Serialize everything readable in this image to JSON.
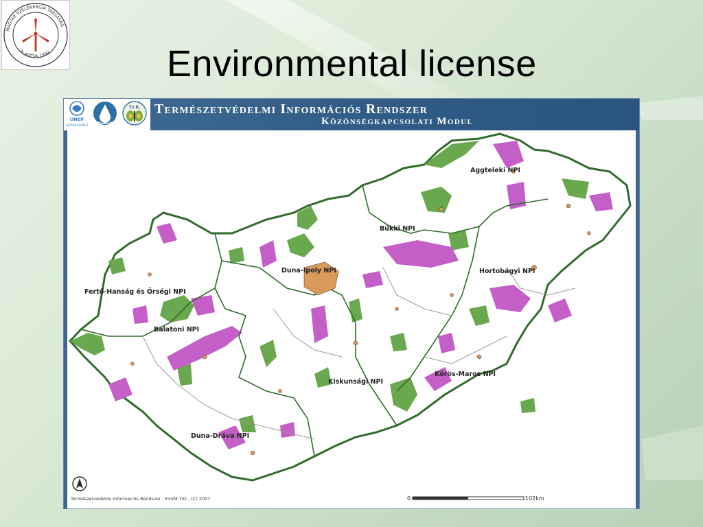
{
  "slide": {
    "title": "Environmental license"
  },
  "logo": {
    "ring_text_top": "MAGYAR SZÉLENERGIA TÁRSASÁG",
    "ring_text_bottom": "ALAPÍTVA 1999"
  },
  "map_header": {
    "title_main": "Természetvédelmi Információs Rendszer",
    "title_sub": "Közönségkapcsolati Modul",
    "logos": [
      {
        "name": "unep-logo",
        "label_top": "UNEP",
        "label_bottom": "GRID-BUDAPEST"
      },
      {
        "name": "water-drop-logo"
      },
      {
        "name": "tir-logo",
        "label": "T.I.R."
      }
    ]
  },
  "map": {
    "park_labels": [
      "Aggteleki NPI",
      "Bükki NPI",
      "Duna-Ipoly NPI",
      "Hortobágyi NPI",
      "Fertő-Hanság és Őrségi NPI",
      "Balatoni NPI",
      "Kiskunsági NPI",
      "Körös-Maros NPI",
      "Duna-Dráva NPI"
    ],
    "footer_credit": "Természetvédelmi Információs Rendszer - KvVM TIO - (C) 2007",
    "scale_start": "0",
    "scale_end": "102km",
    "north_arrow_icon": "north-arrow-icon",
    "colors": {
      "protected_green": "#6aa84f",
      "natura_purple": "#c35fc7",
      "settlement_orange": "#d99a5b",
      "border_dark_green": "#2f6b2a",
      "inner_border_gray": "#9a9a9a"
    }
  }
}
